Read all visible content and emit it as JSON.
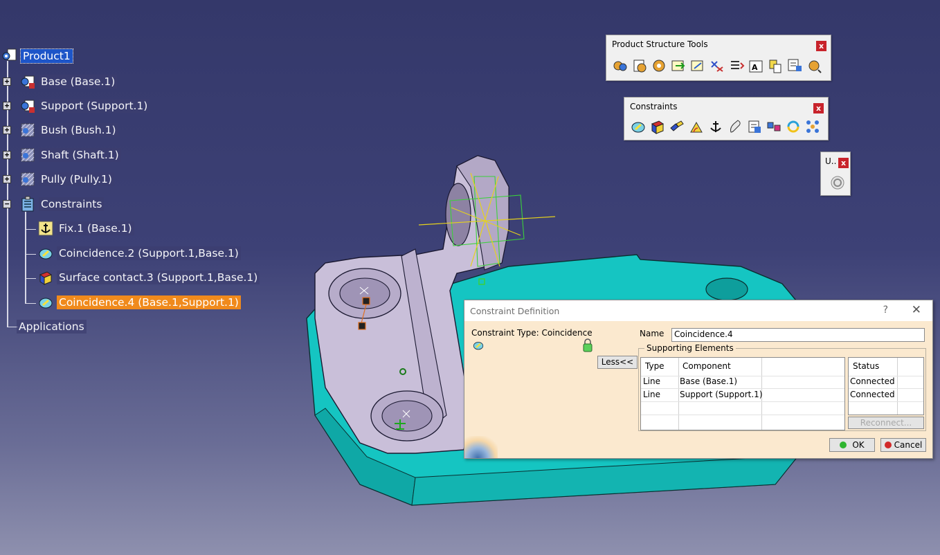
{
  "tree": {
    "root": "Product1",
    "items": [
      {
        "label": "Base (Base.1)"
      },
      {
        "label": "Support (Support.1)"
      },
      {
        "label": "Bush (Bush.1)"
      },
      {
        "label": "Shaft (Shaft.1)"
      },
      {
        "label": "Pully (Pully.1)"
      }
    ],
    "constraints_label": "Constraints",
    "constraints": [
      {
        "label": "Fix.1 (Base.1)"
      },
      {
        "label": "Coincidence.2 (Support.1,Base.1)"
      },
      {
        "label": "Surface contact.3 (Support.1,Base.1)"
      },
      {
        "label": "Coincidence.4 (Base.1,Support.1)"
      }
    ],
    "applications": "Applications",
    "expand_plus": "+",
    "expand_minus": "−"
  },
  "toolbars": {
    "product_structure": {
      "title": "Product Structure Tools",
      "close": "x"
    },
    "constraints": {
      "title": "Constraints",
      "close": "x"
    },
    "update": {
      "title": "U..",
      "close": "x"
    }
  },
  "dialog": {
    "title": "Constraint Definition",
    "help": "?",
    "close": "✕",
    "constraint_type": "Constraint Type: Coincidence",
    "less_button": "Less<<",
    "name_label": "Name",
    "name_value": "Coincidence.4",
    "supporting_elements": "Supporting Elements",
    "columns": {
      "type": "Type",
      "component": "Component",
      "status": "Status"
    },
    "rows": [
      {
        "type": "Line",
        "component": "Base (Base.1)",
        "status": "Connected"
      },
      {
        "type": "Line",
        "component": "Support (Support.1)",
        "status": "Connected"
      }
    ],
    "reconnect": "Reconnect...",
    "ok": "OK",
    "cancel": "Cancel"
  },
  "colors": {
    "background_top": "#34386a",
    "selection_orange": "#f08a1c",
    "selection_blue": "#1d55c8",
    "part_cyan": "#14c7c4",
    "part_lilac": "#c8bcd8",
    "dialog_bg": "#fbe9cf"
  }
}
